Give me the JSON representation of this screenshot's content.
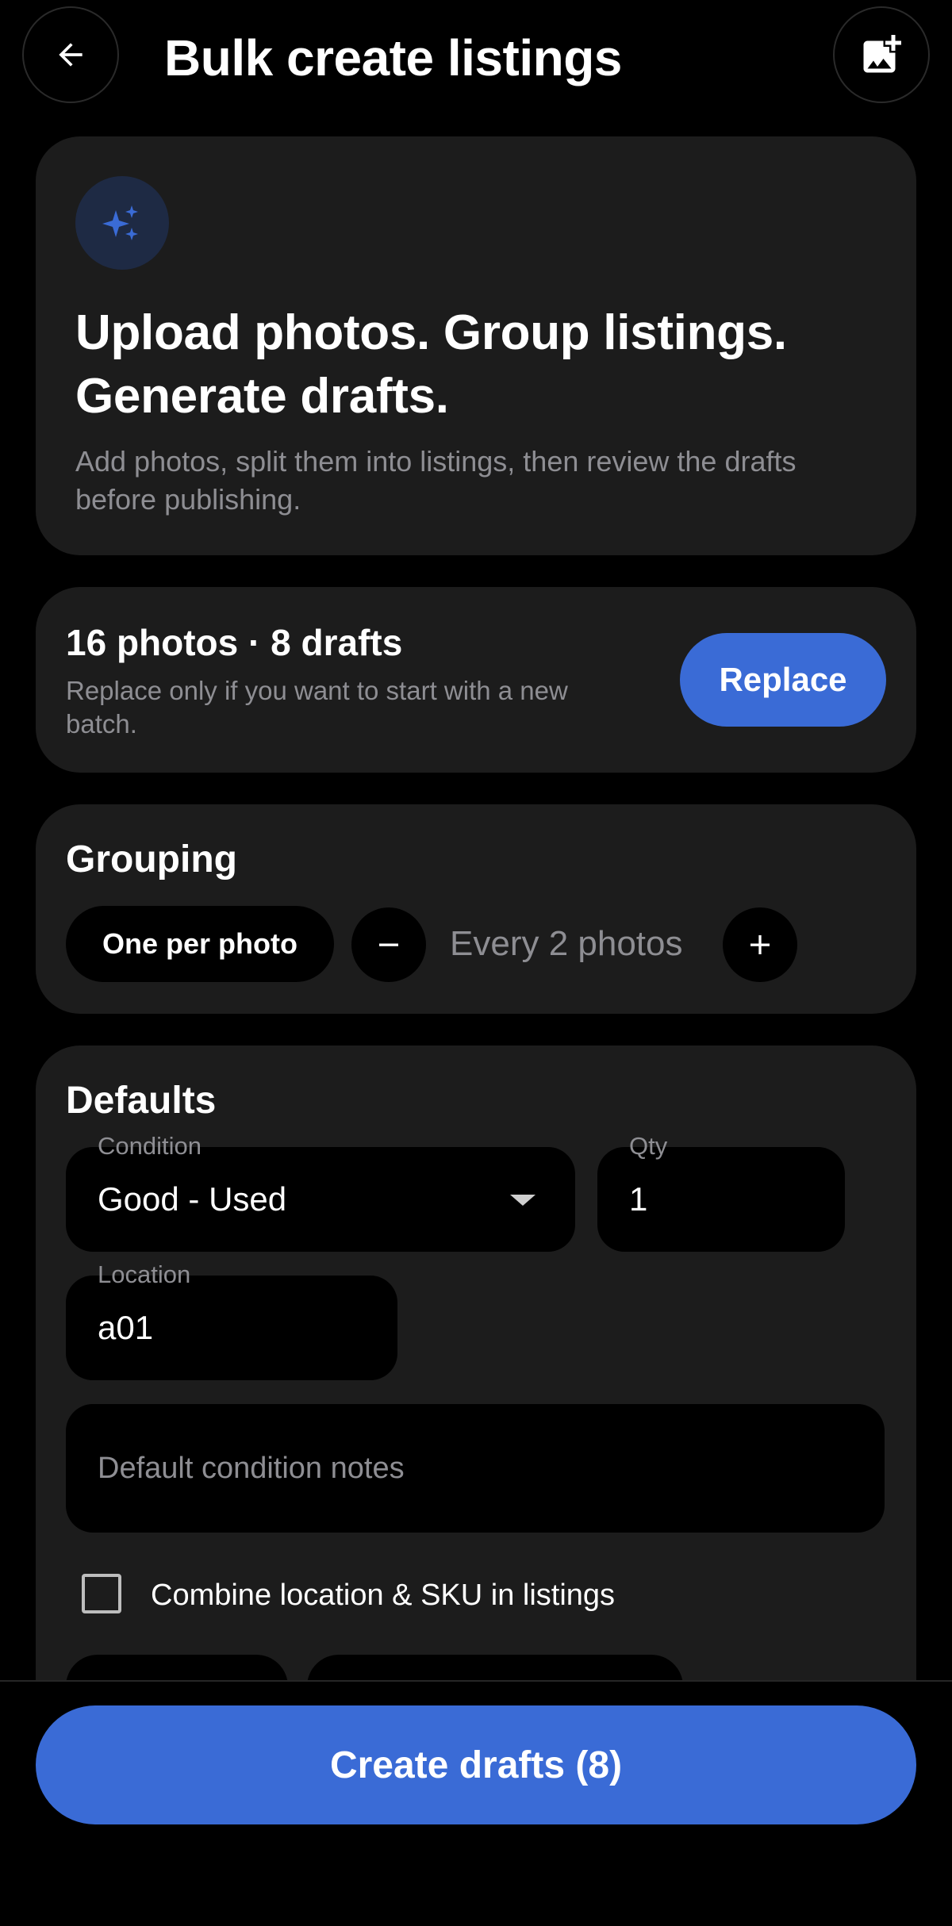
{
  "header": {
    "title": "Bulk create listings",
    "back_icon": "arrow-left-icon",
    "add_photo_icon": "add-photo-icon"
  },
  "hero": {
    "icon": "sparkle-icon",
    "title": "Upload photos. Group listings. Generate drafts.",
    "subtitle": "Add photos, split them into listings, then review the drafts before publishing."
  },
  "batch": {
    "summary": "16 photos · 8 drafts",
    "description": "Replace only if you want to start with a new batch.",
    "replace_label": "Replace"
  },
  "grouping": {
    "title": "Grouping",
    "one_per_photo_label": "One per photo",
    "every_label": "Every 2 photos"
  },
  "defaults": {
    "title": "Defaults",
    "condition": {
      "label": "Condition",
      "value": "Good - Used"
    },
    "qty": {
      "label": "Qty",
      "value": "1"
    },
    "location": {
      "label": "Location",
      "value": "a01"
    },
    "notes": {
      "placeholder": "Default condition notes"
    },
    "combine_checkbox": {
      "label": "Combine location & SKU in listings",
      "checked": false
    }
  },
  "footer": {
    "create_label": "Create drafts (8)"
  },
  "colors": {
    "accent": "#3a6bd6",
    "card": "#1c1c1c",
    "background": "#000000",
    "muted_text": "#8e8e93"
  }
}
